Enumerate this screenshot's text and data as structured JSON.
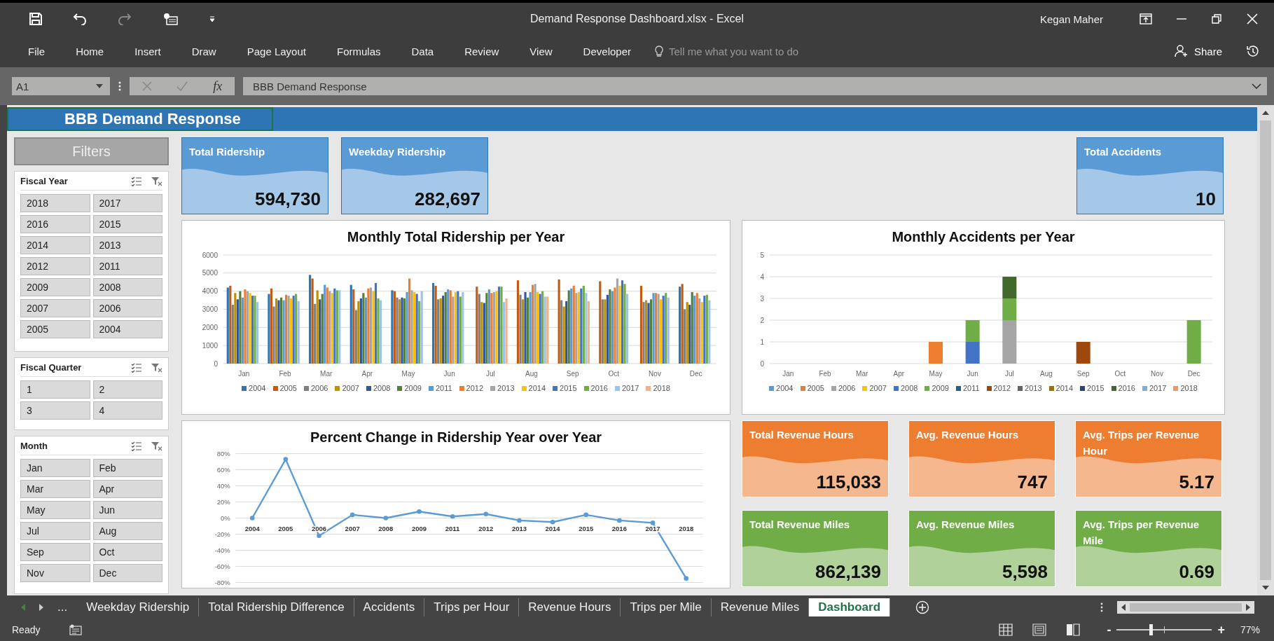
{
  "window": {
    "title": "Demand Response Dashboard.xlsx - Excel",
    "user": "Kegan Maher"
  },
  "ribbon": {
    "tabs": [
      {
        "label": "File",
        "selected": false
      },
      {
        "label": "Home",
        "selected": false
      },
      {
        "label": "Insert",
        "selected": false
      },
      {
        "label": "Draw",
        "selected": false
      },
      {
        "label": "Page Layout",
        "selected": false
      },
      {
        "label": "Formulas",
        "selected": false
      },
      {
        "label": "Data",
        "selected": false
      },
      {
        "label": "Review",
        "selected": false
      },
      {
        "label": "View",
        "selected": false
      },
      {
        "label": "Developer",
        "selected": false
      }
    ],
    "tell_me": {
      "placeholder": "Tell me what you want to do"
    },
    "share": "Share"
  },
  "formula_bar": {
    "name_box": "A1",
    "fx": "fx",
    "value": "BBB Demand Response"
  },
  "sheet": {
    "banner": "BBB Demand Response",
    "filters_label": "Filters",
    "slicers": [
      {
        "title": "Fiscal Year",
        "items": [
          "2018",
          "2017",
          "2016",
          "2015",
          "2014",
          "2013",
          "2012",
          "2011",
          "2009",
          "2008",
          "2007",
          "2006",
          "2005",
          "2004"
        ]
      },
      {
        "title": "Fiscal Quarter",
        "items": [
          "1",
          "2",
          "3",
          "4"
        ]
      },
      {
        "title": "Month",
        "items": [
          "Jan",
          "Feb",
          "Mar",
          "Apr",
          "May",
          "Jun",
          "Jul",
          "Aug",
          "Sep",
          "Oct",
          "Nov",
          "Dec"
        ]
      }
    ],
    "kpi_top": [
      {
        "title": "Total Ridership",
        "value": "594,730",
        "color": "#5b9bd5"
      },
      {
        "title": "Weekday Ridership",
        "value": "282,697",
        "color": "#5b9bd5"
      },
      {
        "title": "Total Accidents",
        "value": "10",
        "color": "#5b9bd5"
      }
    ],
    "charts": [
      {
        "chart_data": {
          "type": "bar",
          "grid": true,
          "legend": "bottom",
          "title": "Monthly Total Ridership per Year",
          "categories": [
            "Jan",
            "Feb",
            "Mar",
            "Apr",
            "May",
            "Jun",
            "Jul",
            "Aug",
            "Sep",
            "Oct",
            "Nov",
            "Dec"
          ],
          "ylim": [
            0,
            6000
          ],
          "yticks": [
            0,
            1000,
            2000,
            3000,
            4000,
            5000,
            6000
          ],
          "series": [
            {
              "name": "2004",
              "color": "#2e75b6",
              "values": [
                4200,
                3850,
                4900,
                4350,
                4050,
                4450,
                null,
                null,
                null,
                null,
                null,
                4250
              ]
            },
            {
              "name": "2005",
              "color": "#c55a11",
              "values": [
                4300,
                4150,
                4700,
                4100,
                4000,
                4300,
                4250,
                4600,
                4650,
                4550,
                4300,
                4400
              ]
            },
            {
              "name": "2006",
              "color": "#7f7f7f",
              "values": [
                3250,
                3150,
                3300,
                2950,
                3650,
                3550,
                3850,
                3800,
                3500,
                3550,
                3400,
                3000
              ]
            },
            {
              "name": "2007",
              "color": "#bf9000",
              "values": [
                3900,
                3600,
                4050,
                3450,
                3550,
                3600,
                3400,
                3550,
                3150,
                3550,
                3500,
                3400
              ]
            },
            {
              "name": "2008",
              "color": "#2f55a4",
              "values": [
                3550,
                3500,
                3550,
                3600,
                3650,
                3750,
                3350,
                3950,
                3450,
                3800,
                3350,
                3250
              ]
            },
            {
              "name": "2009",
              "color": "#548235",
              "values": [
                4000,
                3650,
                3850,
                3900,
                3600,
                3950,
                3900,
                3650,
                4050,
                4100,
                3550,
                3950
              ]
            },
            {
              "name": "2011",
              "color": "#5b9bd5",
              "values": [
                3650,
                3500,
                4350,
                3650,
                3950,
                4100,
                4100,
                3950,
                4150,
                4000,
                3900,
                3750
              ]
            },
            {
              "name": "2012",
              "color": "#ed7d31",
              "values": [
                4100,
                3800,
                4200,
                4150,
                4700,
                4050,
                3900,
                4350,
                4300,
                4200,
                3900,
                3900
              ]
            },
            {
              "name": "2013",
              "color": "#a5a5a5",
              "values": [
                4000,
                3750,
                4000,
                4200,
                4050,
                3700,
                3950,
                4400,
                3900,
                4700,
                3850,
                3600
              ]
            },
            {
              "name": "2014",
              "color": "#ffc000",
              "values": [
                3900,
                3600,
                3900,
                4000,
                3950,
                3950,
                4000,
                3950,
                3950,
                4300,
                3550,
                3400
              ]
            },
            {
              "name": "2015",
              "color": "#4472c4",
              "values": [
                3750,
                3750,
                4150,
                4450,
                3850,
                4000,
                4250,
                3850,
                4150,
                4600,
                3750,
                3750
              ]
            },
            {
              "name": "2016",
              "color": "#70ad47",
              "values": [
                3750,
                3850,
                4050,
                3600,
                3450,
                3700,
                4250,
                4000,
                4300,
                4400,
                3900,
                3800
              ]
            },
            {
              "name": "2017",
              "color": "#9dc3e6",
              "values": [
                3400,
                3450,
                4050,
                3500,
                4000,
                3950,
                3400,
                3700,
                3900,
                3850,
                3650,
                3500
              ]
            },
            {
              "name": "2018",
              "color": "#f4b183",
              "values": [
                null,
                null,
                null,
                null,
                null,
                null,
                3600,
                3700,
                3450,
                null,
                null,
                null
              ]
            }
          ]
        }
      },
      {
        "chart_data": {
          "type": "bar",
          "stacked": true,
          "grid": true,
          "legend": "bottom",
          "title": "Monthly Accidents per Year",
          "categories": [
            "Jan",
            "Feb",
            "Mar",
            "Apr",
            "May",
            "Jun",
            "Jul",
            "Aug",
            "Sep",
            "Oct",
            "Nov",
            "Dec"
          ],
          "ylim": [
            0,
            5
          ],
          "yticks": [
            0,
            1,
            2,
            3,
            4,
            5
          ],
          "series": [
            {
              "name": "2004",
              "color": "#5b9bd5",
              "values": [
                0,
                0,
                0,
                0,
                0,
                0,
                0,
                0,
                0,
                0,
                0,
                0
              ]
            },
            {
              "name": "2005",
              "color": "#ed7d31",
              "values": [
                0,
                0,
                0,
                0,
                1,
                0,
                0,
                0,
                0,
                0,
                0,
                0
              ]
            },
            {
              "name": "2006",
              "color": "#a5a5a5",
              "values": [
                0,
                0,
                0,
                0,
                0,
                0,
                2,
                0,
                0,
                0,
                0,
                0
              ]
            },
            {
              "name": "2007",
              "color": "#ffc000",
              "values": [
                0,
                0,
                0,
                0,
                0,
                0,
                0,
                0,
                0,
                0,
                0,
                0
              ]
            },
            {
              "name": "2008",
              "color": "#4472c4",
              "values": [
                0,
                0,
                0,
                0,
                0,
                1,
                0,
                0,
                0,
                0,
                0,
                0
              ]
            },
            {
              "name": "2009",
              "color": "#70ad47",
              "values": [
                0,
                0,
                0,
                0,
                0,
                1,
                1,
                0,
                0,
                0,
                0,
                2
              ]
            },
            {
              "name": "2011",
              "color": "#255e91",
              "values": [
                0,
                0,
                0,
                0,
                0,
                0,
                0,
                0,
                0,
                0,
                0,
                0
              ]
            },
            {
              "name": "2012",
              "color": "#9e480e",
              "values": [
                0,
                0,
                0,
                0,
                0,
                0,
                0,
                0,
                1,
                0,
                0,
                0
              ]
            },
            {
              "name": "2013",
              "color": "#636363",
              "values": [
                0,
                0,
                0,
                0,
                0,
                0,
                0,
                0,
                0,
                0,
                0,
                0
              ]
            },
            {
              "name": "2014",
              "color": "#997300",
              "values": [
                0,
                0,
                0,
                0,
                0,
                0,
                0,
                0,
                0,
                0,
                0,
                0
              ]
            },
            {
              "name": "2015",
              "color": "#264478",
              "values": [
                0,
                0,
                0,
                0,
                0,
                0,
                0,
                0,
                0,
                0,
                0,
                0
              ]
            },
            {
              "name": "2016",
              "color": "#43682b",
              "values": [
                0,
                0,
                0,
                0,
                0,
                0,
                1,
                0,
                0,
                0,
                0,
                0
              ]
            },
            {
              "name": "2017",
              "color": "#7cafdd",
              "values": [
                0,
                0,
                0,
                0,
                0,
                0,
                0,
                0,
                0,
                0,
                0,
                0
              ]
            },
            {
              "name": "2018",
              "color": "#f1975a",
              "values": [
                0,
                0,
                0,
                0,
                0,
                0,
                0,
                0,
                0,
                0,
                0,
                0
              ]
            }
          ]
        }
      },
      {
        "chart_data": {
          "type": "line",
          "grid": true,
          "marker": true,
          "title": "Percent Change in Ridership Year over Year",
          "categories": [
            "2004",
            "2005",
            "2006",
            "2007",
            "2008",
            "2009",
            "2011",
            "2012",
            "2013",
            "2014",
            "2015",
            "2016",
            "2017",
            "2018"
          ],
          "ylim": [
            -0.8,
            0.8
          ],
          "yticks": [
            {
              "value": -0.8,
              "label": "-80%"
            },
            {
              "value": -0.6,
              "label": "-60%"
            },
            {
              "value": -0.4,
              "label": "-40%"
            },
            {
              "value": -0.2,
              "label": "-20%"
            },
            {
              "value": 0,
              "label": "0%"
            },
            {
              "value": 0.2,
              "label": "20%"
            },
            {
              "value": 0.4,
              "label": "40%"
            },
            {
              "value": 0.6,
              "label": "60%"
            },
            {
              "value": 0.8,
              "label": "80%"
            }
          ],
          "values": [
            0,
            0.73,
            -0.22,
            0.04,
            0,
            0.08,
            0.02,
            0.05,
            -0.03,
            -0.05,
            0.04,
            -0.03,
            -0.06,
            -0.75
          ]
        }
      }
    ],
    "kpi_grid": [
      {
        "title": "Total Revenue Hours",
        "value": "115,033",
        "color": "#ed7d31"
      },
      {
        "title": "Avg. Revenue Hours",
        "value": "747",
        "color": "#ed7d31"
      },
      {
        "title": "Avg. Trips per Revenue Hour",
        "value": "5.17",
        "color": "#ed7d31"
      },
      {
        "title": "Total Revenue Miles",
        "value": "862,139",
        "color": "#70ad47"
      },
      {
        "title": "Avg. Revenue Miles",
        "value": "5,598",
        "color": "#70ad47"
      },
      {
        "title": "Avg. Trips per Revenue Mile",
        "value": "0.69",
        "color": "#70ad47"
      }
    ]
  },
  "sheet_tabs": {
    "more": "...",
    "tabs": [
      {
        "label": "Weekday Ridership",
        "selected": false
      },
      {
        "label": "Total Ridership Difference",
        "selected": false
      },
      {
        "label": "Accidents",
        "selected": false
      },
      {
        "label": "Trips per Hour",
        "selected": false
      },
      {
        "label": "Revenue Hours",
        "selected": false
      },
      {
        "label": "Trips per Mile",
        "selected": false
      },
      {
        "label": "Revenue Miles",
        "selected": false
      },
      {
        "label": "Dashboard",
        "selected": true
      }
    ]
  },
  "status_bar": {
    "status": "Ready",
    "zoom": {
      "minus": "-",
      "plus": "+",
      "level": 0.36,
      "reading": "77%"
    }
  }
}
